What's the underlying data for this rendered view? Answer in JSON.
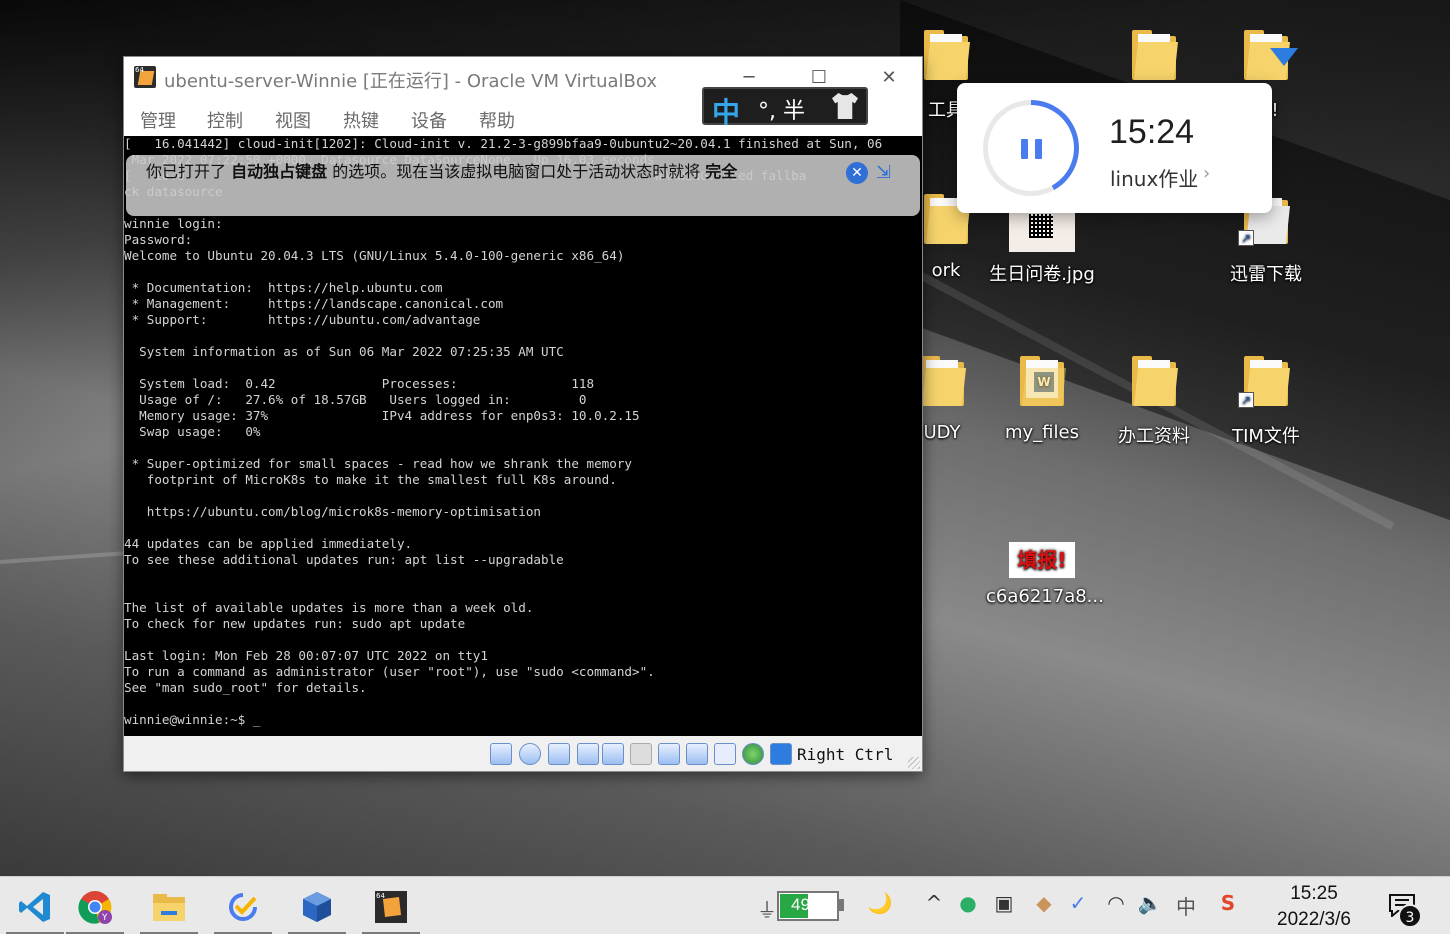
{
  "desktop": {
    "icons": [
      {
        "label": "工具",
        "kind": "folder"
      },
      {
        "label": "",
        "kind": "folder"
      },
      {
        "label": "载!",
        "kind": "folder-download"
      },
      {
        "label": "ork",
        "kind": "folder"
      },
      {
        "label": "生日问卷.jpg",
        "kind": "image"
      },
      {
        "label": "迅雷下载",
        "kind": "folder-shortcut"
      },
      {
        "label": "UDY",
        "kind": "folder"
      },
      {
        "label": "my_files",
        "kind": "word-folder"
      },
      {
        "label": "办工资料",
        "kind": "folder"
      },
      {
        "label": "TIM文件",
        "kind": "folder-shortcut"
      },
      {
        "label": "c6a6217a8...",
        "kind": "image"
      }
    ],
    "fill_report_text": "填报!"
  },
  "vbox": {
    "title": "ubentu-server-Winnie [正在运行] - Oracle VM VirtualBox",
    "app_icon_badge": "64",
    "menu": [
      "管理",
      "控制",
      "视图",
      "热键",
      "设备",
      "帮助"
    ],
    "ime": {
      "mode": "中",
      "punct": "°, 半"
    },
    "notice": {
      "pre": "你已打开了 ",
      "bold1": "自动独占键盘",
      "mid": " 的选项。现在当该虚拟电脑窗口处于活动状态时就将 ",
      "bold2": "完全"
    },
    "terminal_lines": [
      "[   16.041442] cloud-init[1202]: Cloud-init v. 21.2-3-g899bfaa9-0ubuntu2~20.04.1 finished at Sun, 06",
      " Mar 2022 07:22:50 +0000. Datasource DataSourceNone.  Up 16.03 seconds",
      "[   16.0                                                              WARNING: Used fallba",
      "ck datasource",
      "",
      "winnie login:",
      "Password:",
      "Welcome to Ubuntu 20.04.3 LTS (GNU/Linux 5.4.0-100-generic x86_64)",
      "",
      " * Documentation:  https://help.ubuntu.com",
      " * Management:     https://landscape.canonical.com",
      " * Support:        https://ubuntu.com/advantage",
      "",
      "  System information as of Sun 06 Mar 2022 07:25:35 AM UTC",
      "",
      "  System load:  0.42              Processes:               118",
      "  Usage of /:   27.6% of 18.57GB   Users logged in:         0",
      "  Memory usage: 37%               IPv4 address for enp0s3: 10.0.2.15",
      "  Swap usage:   0%",
      "",
      " * Super-optimized for small spaces - read how we shrank the memory",
      "   footprint of MicroK8s to make it the smallest full K8s around.",
      "",
      "   https://ubuntu.com/blog/microk8s-memory-optimisation",
      "",
      "44 updates can be applied immediately.",
      "To see these additional updates run: apt list --upgradable",
      "",
      "",
      "The list of available updates is more than a week old.",
      "To check for new updates run: sudo apt update",
      "",
      "Last login: Mon Feb 28 00:07:07 UTC 2022 on tty1",
      "To run a command as administrator (user \"root\"), use \"sudo <command>\".",
      "See \"man sudo_root\" for details.",
      "",
      "winnie@winnie:~$ _"
    ],
    "host_key": "Right Ctrl"
  },
  "timer": {
    "time": "15:24",
    "task": "linux作业",
    "progress": 0.42
  },
  "taskbar": {
    "apps": [
      "vscode",
      "chrome",
      "file-explorer",
      "ticktick",
      "virtualbox",
      "virtualbox-vm"
    ],
    "battery_percent": "49%",
    "battery_level": 0.49,
    "ime_indicator": "中",
    "clock_time": "15:25",
    "clock_date": "2022/3/6",
    "notification_count": "3"
  },
  "colors": {
    "accent": "#4a7cf0",
    "terminal_bg": "#000000",
    "battery": "#28a745"
  }
}
